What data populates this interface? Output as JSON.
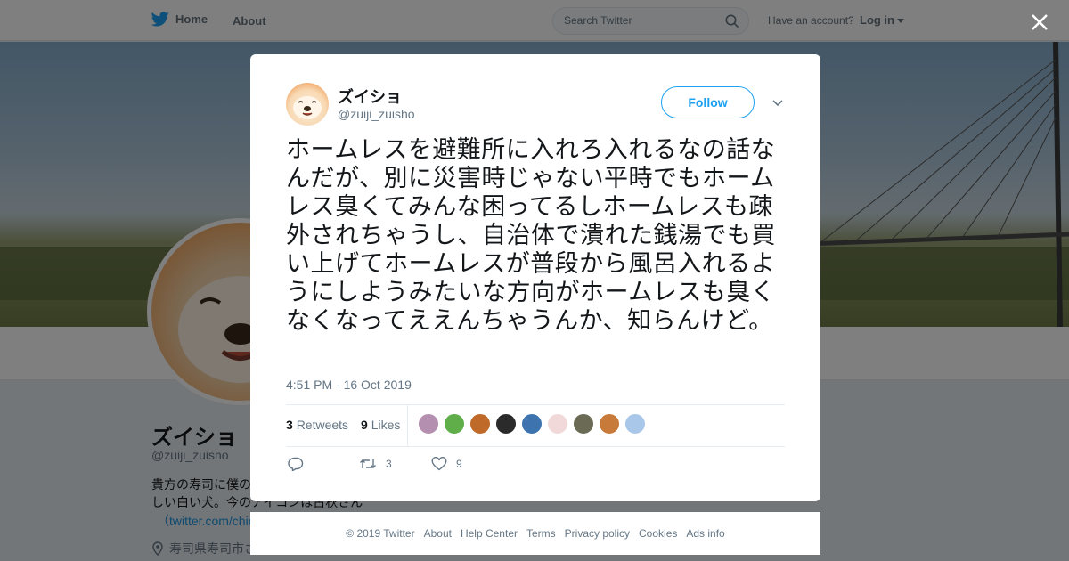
{
  "nav": {
    "home_label": "Home",
    "about_label": "About",
    "search_placeholder": "Search Twitter",
    "have_account": "Have an account?",
    "login_label": "Log in"
  },
  "profile": {
    "name": "ズイショ",
    "handle": "@zuiji_zuisho",
    "bio_line1": "貴方の寿司に僕の",
    "bio_line2": "しい白い犬。今のアイコンは古秋さん",
    "bio_link": "（twitter.com/chic",
    "location": "寿司県寿司市さ"
  },
  "tweet": {
    "author_name": "ズイショ",
    "author_handle": "@zuiji_zuisho",
    "follow_label": "Follow",
    "text": "ホームレスを避難所に入れろ入れるなの話なんだが、別に災害時じゃない平時でもホームレス臭くてみんな困ってるしホームレスも疎外されちゃうし、自治体で潰れた銭湯でも買い上げてホームレスが普段から風呂入れるようにしようみたいな方向がホームレスも臭くなくなってええんちゃうんか、知らんけど。",
    "timestamp": "4:51 PM - 16 Oct 2019",
    "retweets_count": "3",
    "retweets_label": "Retweets",
    "likes_count": "9",
    "likes_label": "Likes",
    "action_retweet_count": "3",
    "action_like_count": "9",
    "liker_colors": [
      "#b58fb0",
      "#5fae4a",
      "#c06a2a",
      "#2b2b2b",
      "#3d74b0",
      "#f1d9d9",
      "#6b6b55",
      "#c87a3a",
      "#a9c7e8"
    ]
  },
  "footer": {
    "links": [
      "© 2019 Twitter",
      "About",
      "Help Center",
      "Terms",
      "Privacy policy",
      "Cookies",
      "Ads info"
    ]
  },
  "colors": {
    "accent": "#1da1f2",
    "overlay": "rgba(0,0,0,0.5)"
  }
}
